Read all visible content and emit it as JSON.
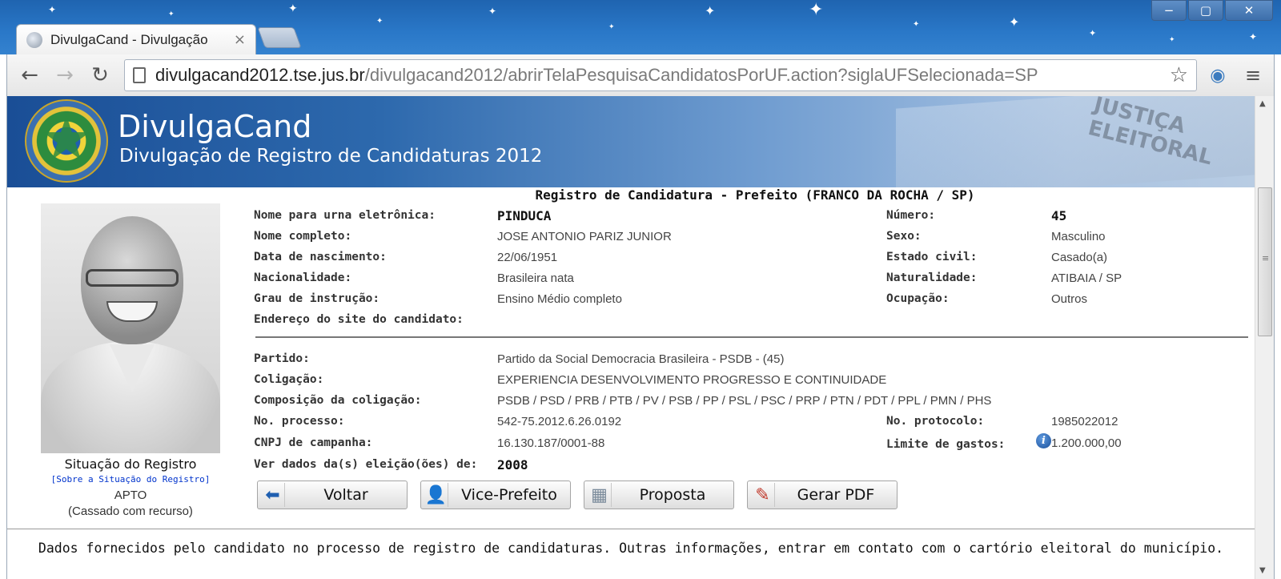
{
  "browser": {
    "tab_title": "DivulgaCand - Divulgação",
    "tab_close": "×",
    "url_host": "divulgacand2012.tse.jus.br",
    "url_path": "/divulgacand2012/abrirTelaPesquisaCandidatosPorUF.action?siglaUFSelecionada=SP",
    "icons": {
      "back": "←",
      "forward": "→",
      "reload": "↻",
      "bookmark": "☆",
      "extension": "◉",
      "menu": "≡",
      "minimize": "−",
      "maximize": "▢",
      "close": "✕"
    }
  },
  "banner": {
    "title": "DivulgaCand",
    "subtitle": "Divulgação de Registro de Candidaturas 2012",
    "ballot_text": "JUSTIÇA\nELEITORAL"
  },
  "situation": {
    "title": "Situação do Registro",
    "link": "[Sobre a Situação do Registro]",
    "status": "APTO",
    "note": "(Cassado com recurso)"
  },
  "record": {
    "title": "Registro de Candidatura - Prefeito (FRANCO DA ROCHA / SP)",
    "left_fields": [
      {
        "label": "Nome para urna eletrônica:",
        "value": "PINDUCA"
      },
      {
        "label": "Nome completo:",
        "value": "JOSE ANTONIO PARIZ JUNIOR"
      },
      {
        "label": "Data de nascimento:",
        "value": "22/06/1951"
      },
      {
        "label": "Nacionalidade:",
        "value": "Brasileira nata"
      },
      {
        "label": "Grau de instrução:",
        "value": "Ensino Médio completo"
      },
      {
        "label": "Endereço do site do candidato:",
        "value": ""
      }
    ],
    "right_fields": [
      {
        "label": "Número:",
        "value": "45"
      },
      {
        "label": "Sexo:",
        "value": "Masculino"
      },
      {
        "label": "Estado civil:",
        "value": "Casado(a)"
      },
      {
        "label": "Naturalidade:",
        "value": "ATIBAIA / SP"
      },
      {
        "label": "Ocupação:",
        "value": "Outros"
      }
    ],
    "lower_fields": [
      {
        "label": "Partido:",
        "value": "Partido da Social Democracia Brasileira -  PSDB - (45)"
      },
      {
        "label": "Coligação:",
        "value": "EXPERIENCIA DESENVOLVIMENTO PROGRESSO E CONTINUIDADE"
      },
      {
        "label": "Composição da coligação:",
        "value": "PSDB / PSD / PRB / PTB / PV / PSB / PP / PSL / PSC / PRP / PTN / PDT / PPL / PMN / PHS"
      },
      {
        "label": "No. processo:",
        "value": "542-75.2012.6.26.0192"
      },
      {
        "label": "CNPJ de campanha:",
        "value": "16.130.187/0001-88"
      },
      {
        "label": "Ver dados da(s) eleição(ões) de:",
        "value": "2008"
      }
    ],
    "lower_right_fields": [
      {
        "label": "No. protocolo:",
        "value": "1985022012"
      },
      {
        "label": "Limite de gastos:",
        "value": "1.200.000,00"
      }
    ],
    "info_glyph": "i"
  },
  "buttons": [
    {
      "label": "Voltar",
      "icon": "⬅"
    },
    {
      "label": "Vice-Prefeito",
      "icon": "👤"
    },
    {
      "label": "Proposta",
      "icon": "▦"
    },
    {
      "label": "Gerar PDF",
      "icon": "✎"
    }
  ],
  "footer": {
    "text": "Dados fornecidos pelo candidato no processo de registro de candidaturas.  Outras informações, entrar em contato com o cartório eleitoral do município."
  },
  "colors": {
    "chrome_blue": "#2a78c8",
    "banner_dark": "#1a4e96",
    "link_blue": "#0033cc"
  }
}
